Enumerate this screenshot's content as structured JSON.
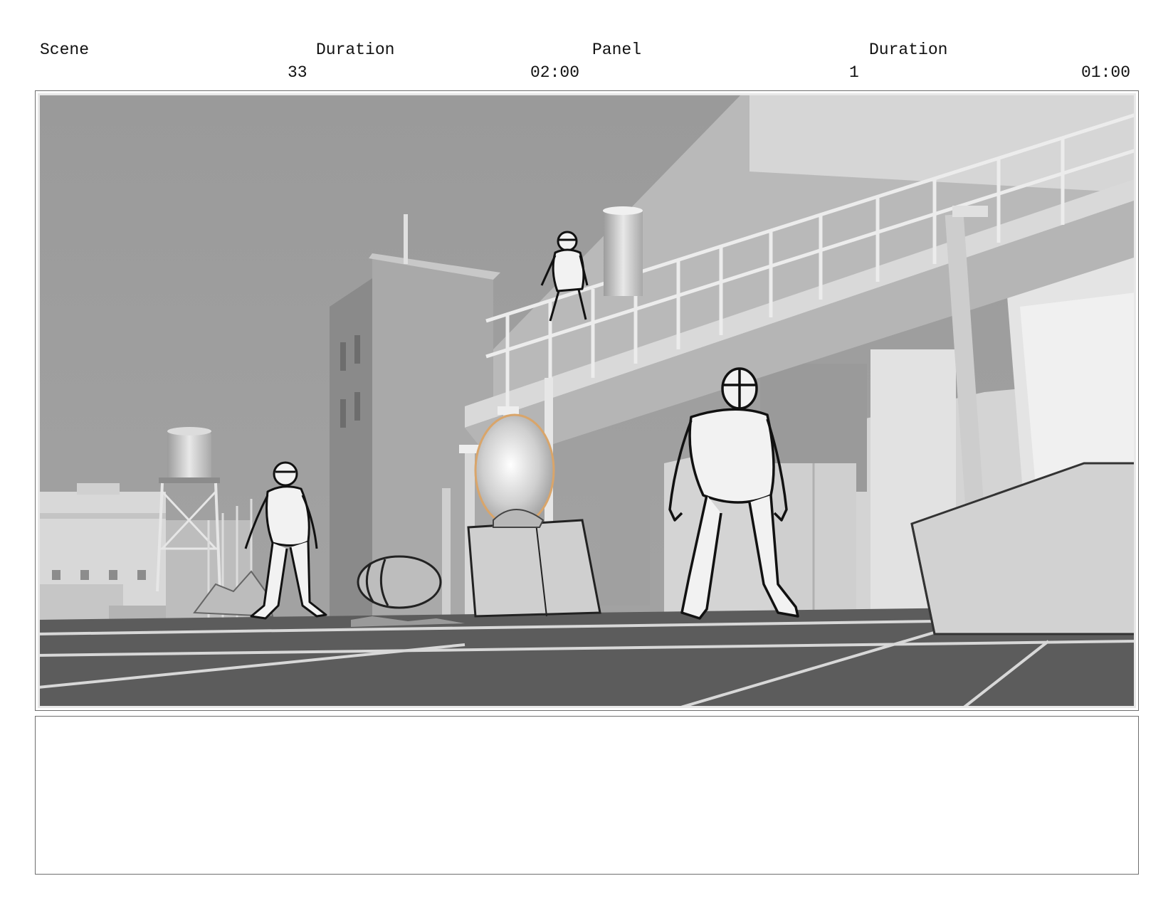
{
  "header": {
    "scene_label": "Scene",
    "scene_duration_label": "Duration",
    "panel_label": "Panel",
    "panel_duration_label": "Duration",
    "scene_value": "33",
    "scene_duration_value": "02:00",
    "panel_value": "1",
    "panel_duration_value": "01:00"
  },
  "notes": {
    "text": ""
  }
}
